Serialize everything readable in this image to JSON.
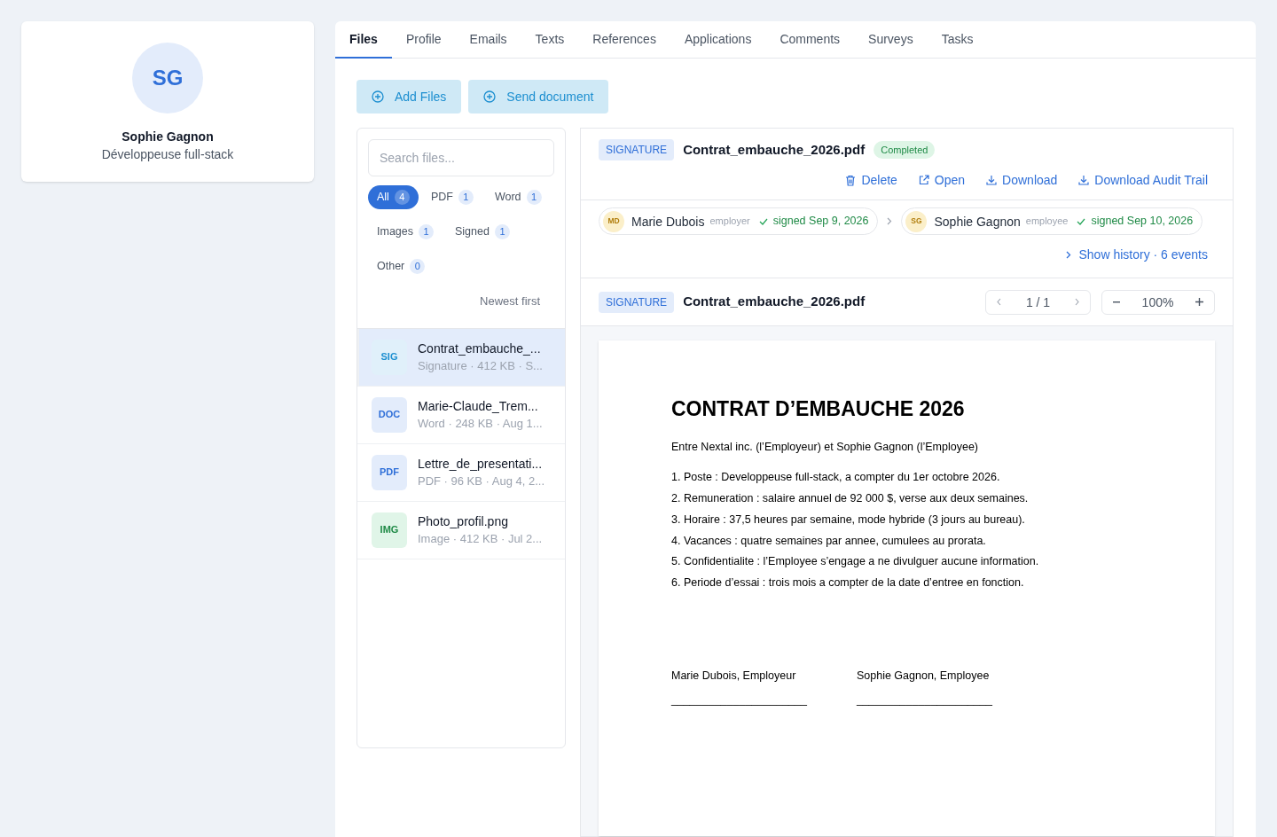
{
  "profile": {
    "initials": "SG",
    "name": "Sophie Gagnon",
    "role": "Développeuse full-stack"
  },
  "tabs": [
    {
      "label": "Files",
      "selected": true
    },
    {
      "label": "Profile",
      "selected": false
    },
    {
      "label": "Emails",
      "selected": false
    },
    {
      "label": "Texts",
      "selected": false
    },
    {
      "label": "References",
      "selected": false
    },
    {
      "label": "Applications",
      "selected": false
    },
    {
      "label": "Comments",
      "selected": false
    },
    {
      "label": "Surveys",
      "selected": false
    },
    {
      "label": "Tasks",
      "selected": false
    }
  ],
  "actions": [
    "Add Files",
    "Send document"
  ],
  "file_list": {
    "search": {
      "placeholder": "Search files..."
    },
    "filters": [
      {
        "label": "All",
        "count": "4",
        "selected": true
      },
      {
        "label": "PDF",
        "count": "1",
        "selected": false
      },
      {
        "label": "Word",
        "count": "1",
        "selected": false
      },
      {
        "label": "Images",
        "count": "1",
        "selected": false
      },
      {
        "label": "Signed",
        "count": "1",
        "selected": false
      },
      {
        "label": "Other",
        "count": "0",
        "selected": false
      }
    ],
    "sort": "Newest first",
    "files": [
      {
        "kind": "sig",
        "badge": "SIG",
        "name": "Contrat_embauche_...",
        "meta": "Signature · 412 KB · S...",
        "selected": true
      },
      {
        "kind": "doc",
        "badge": "DOC",
        "name": "Marie-Claude_Trem...",
        "meta": "Word · 248 KB · Aug 1...",
        "selected": false
      },
      {
        "kind": "pdf",
        "badge": "PDF",
        "name": "Lettre_de_presentati...",
        "meta": "PDF · 96 KB · Aug 4, 2...",
        "selected": false
      },
      {
        "kind": "img",
        "badge": "IMG",
        "name": "Photo_profil.png",
        "meta": "Image · 412 KB · Jul 2...",
        "selected": false
      }
    ]
  },
  "detail": {
    "tag": "SIGNATURE",
    "filename": "Contrat_embauche_2026.pdf",
    "status": "Completed",
    "actions": [
      {
        "kind": "delete",
        "label": "Delete"
      },
      {
        "kind": "open",
        "label": "Open"
      },
      {
        "kind": "download",
        "label": "Download"
      },
      {
        "kind": "download",
        "label": "Download Audit Trail"
      }
    ],
    "signers": [
      {
        "initials": "MD",
        "name": "Marie Dubois",
        "role": "employer",
        "signed": "signed Sep 9, 2026"
      },
      {
        "initials": "SG",
        "name": "Sophie Gagnon",
        "role": "employee",
        "signed": "signed Sep 10, 2026"
      }
    ],
    "history": "Show history · 6 events"
  },
  "viewer": {
    "tag": "SIGNATURE",
    "filename": "Contrat_embauche_2026.pdf",
    "page": "1 / 1",
    "zoom": "100%",
    "document": {
      "title": "CONTRAT D’EMBAUCHE 2026",
      "intro": "Entre Nextal inc. (l’Employeur) et Sophie Gagnon (l’Employee)",
      "clauses": [
        "1. Poste : Developpeuse full-stack, a compter du 1er octobre 2026.",
        "2. Remuneration : salaire annuel de 92 000 $, verse aux deux semaines.",
        "3. Horaire : 37,5 heures par semaine, mode hybride (3 jours au bureau).",
        "4. Vacances : quatre semaines par annee, cumulees au prorata.",
        "5. Confidentialite : l’Employee s’engage a ne divulguer aucune information.",
        "6. Periode d’essai : trois mois a compter de la date d’entree en fonction."
      ],
      "signatures": [
        {
          "label": "Marie Dubois, Employeur",
          "line": "______________________"
        },
        {
          "label": "Sophie Gagnon, Employee",
          "line": "______________________"
        }
      ]
    }
  }
}
